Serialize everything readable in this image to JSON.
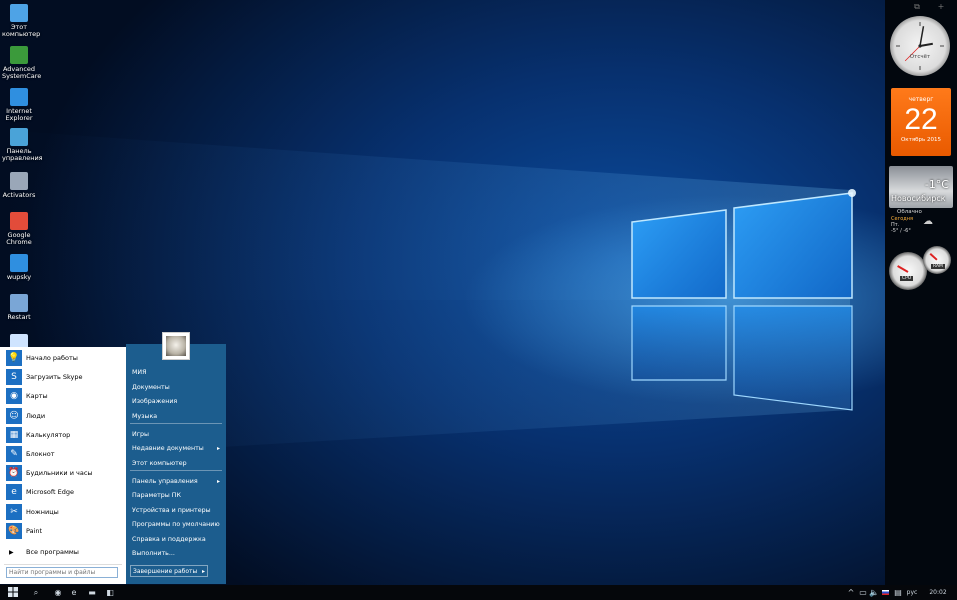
{
  "desktop": {
    "icons": [
      {
        "label": "Этот компьютер",
        "color": "#4ea3e6"
      },
      {
        "label": "Advanced SystemCare",
        "color": "#3b9a3b"
      },
      {
        "label": "Internet Explorer",
        "color": "#2f8fe0"
      },
      {
        "label": "Панель управления",
        "color": "#4aa3d8"
      },
      {
        "label": "Activators",
        "color": "#9aa7b8"
      },
      {
        "label": "Google Chrome",
        "color": "#e24c3a"
      },
      {
        "label": "wupsky",
        "color": "#2f8fe0"
      },
      {
        "label": "Restart",
        "color": "#7aa6d6"
      },
      {
        "label": "",
        "color": "#cfe4ff"
      }
    ]
  },
  "gadgets": {
    "toolbar_icons": [
      "window-icon",
      "plus-icon"
    ],
    "clock": {
      "label": "Отсчёт",
      "hour_angle": 80,
      "minute_angle": 10,
      "second_angle": 225
    },
    "calendar": {
      "weekday": "четверг",
      "day": "22",
      "month_year": "Октябрь 2015"
    },
    "weather": {
      "city": "Новосибирск",
      "temp": "-1°C",
      "condition": "Облачно",
      "today": "Сегодня",
      "day": "Пт.",
      "range": "-5° / -6°"
    },
    "meter": {
      "cpu_label": "CPU",
      "ram_label": "RAM",
      "cpu_level": 0.25,
      "ram_level": 0.3
    }
  },
  "start_menu": {
    "left_items": [
      {
        "label": "Начало работы",
        "icon": "lightbulb-icon",
        "glyph": "💡"
      },
      {
        "label": "Загрузить Skype",
        "icon": "skype-icon",
        "glyph": "S"
      },
      {
        "label": "Карты",
        "icon": "map-icon",
        "glyph": "◉"
      },
      {
        "label": "Люди",
        "icon": "people-icon",
        "glyph": "☺"
      },
      {
        "label": "Калькулятор",
        "icon": "calculator-icon",
        "glyph": "▦"
      },
      {
        "label": "Блокнот",
        "icon": "notepad-icon",
        "glyph": "✎"
      },
      {
        "label": "Будильники и часы",
        "icon": "alarm-icon",
        "glyph": "⏰"
      },
      {
        "label": "Microsoft Edge",
        "icon": "edge-icon",
        "glyph": "e"
      },
      {
        "label": "Ножницы",
        "icon": "scissors-icon",
        "glyph": "✂"
      },
      {
        "label": "Paint",
        "icon": "paint-icon",
        "glyph": "🎨"
      }
    ],
    "all_programs": "Все программы",
    "search_placeholder": "Найти программы и файлы",
    "right_items": [
      {
        "label": "МИЯ",
        "arrow": ""
      },
      {
        "label": "Документы",
        "arrow": ""
      },
      {
        "label": "Изображения",
        "arrow": ""
      },
      {
        "label": "Музыка",
        "arrow": ""
      },
      {
        "label": "Игры",
        "arrow": ""
      },
      {
        "label": "Недавние документы",
        "arrow": "▸"
      },
      {
        "label": "Этот компьютер",
        "arrow": ""
      },
      {
        "label": "Панель управления",
        "arrow": "▸"
      },
      {
        "label": "Параметры ПК",
        "arrow": ""
      },
      {
        "label": "Устройства и принтеры",
        "arrow": ""
      },
      {
        "label": "Программы по умолчанию",
        "arrow": ""
      },
      {
        "label": "Справка и поддержка",
        "arrow": ""
      },
      {
        "label": "Выполнить...",
        "arrow": ""
      }
    ],
    "shutdown": "Завершение работы",
    "shutdown_arrow": "▸"
  },
  "taskbar": {
    "start_icon": "windows-icon",
    "pinned": [
      {
        "name": "search-icon",
        "glyph": "⌕"
      },
      {
        "name": "chrome-taskbar-icon",
        "glyph": "◉"
      },
      {
        "name": "edge-taskbar-icon",
        "glyph": "e"
      },
      {
        "name": "explorer-taskbar-icon",
        "glyph": "▬"
      },
      {
        "name": "store-taskbar-icon",
        "glyph": "◧"
      }
    ],
    "tray": {
      "chevron": "^",
      "language": "рус",
      "time": "20:02"
    }
  },
  "colors": {
    "accent": "#1c5d8e",
    "calendar": "#f26a0c"
  }
}
